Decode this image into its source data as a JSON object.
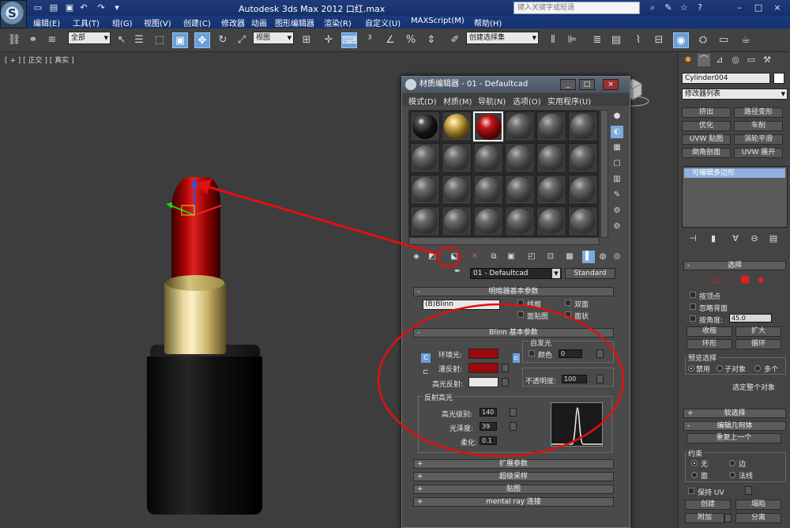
{
  "titlebar": {
    "title": "Autodesk 3ds Max  2012",
    "file": "口红.max",
    "search_placeholder": "键入关键字或短语"
  },
  "menubar": {
    "items": [
      "编辑(E)",
      "工具(T)",
      "组(G)",
      "视图(V)",
      "创建(C)",
      "修改器",
      "动画",
      "图形编辑器",
      "渲染(R)",
      "自定义(U)",
      "MAXScript(M)",
      "帮助(H)"
    ]
  },
  "toolbar": {
    "filter_select": "全部",
    "view_select": "视图",
    "selection_set": "创建选择集"
  },
  "viewport": {
    "label": "[ + ] [ 正交 ] [ 真实 ]"
  },
  "material_editor": {
    "title": "材质编辑器 - 01 - Defaultcad",
    "menu": [
      "模式(D)",
      "材质(M)",
      "导航(N)",
      "选项(O)",
      "实用程序(U)"
    ],
    "material_name": "01 - Defaultcad",
    "material_type": "Standard",
    "shader_rollout": "明暗器基本参数",
    "shader": "(B)Blinn",
    "wire": "线框",
    "two_sided": "双面",
    "face_map": "面贴图",
    "faceted": "面状",
    "blinn_rollout": "Blinn 基本参数",
    "self_illum_title": "自发光",
    "self_illum_color": "颜色",
    "self_illum_value": "0",
    "ambient": "环境光:",
    "diffuse": "漫反射:",
    "specular": "高光反射:",
    "opacity_label": "不透明度:",
    "opacity_value": "100",
    "spec_highlights": "反射高光",
    "spec_level_label": "高光级别:",
    "spec_level": "140",
    "glossiness_label": "光泽度:",
    "glossiness": "39",
    "soften_label": "柔化:",
    "soften": "0.1",
    "more_rollouts": [
      "扩展参数",
      "超级采样",
      "贴图",
      "mental ray 连接"
    ],
    "colors": {
      "ambient": "#9b0a0a",
      "diffuse": "#9b0a0a",
      "specular": "#e8e8e8"
    }
  },
  "command_panel": {
    "object_name": "Cylinder004",
    "modifier_list": "修改器列表",
    "modifier_buttons": [
      "挤出",
      "路径变形",
      "优化",
      "车削",
      "UVW 贴图",
      "涡轮平滑",
      "倒角剖面",
      "UVW 展开"
    ],
    "stack_item": "可编辑多边形",
    "selection_title": "选择",
    "by_vertex": "按顶点",
    "ignore_backfacing": "忽略背面",
    "by_angle": "按角度:",
    "angle_value": "45.0",
    "shrink": "收缩",
    "grow": "扩大",
    "ring": "环形",
    "loop": "循环",
    "preview_title": "预览选择",
    "preview_options": [
      "禁用",
      "子对象",
      "多个"
    ],
    "select_whole": "选定整个对象",
    "soft_selection": "软选择",
    "edit_geometry": "编辑几何体",
    "repeat_last": "重复上一个",
    "constraints_title": "约束",
    "constraints": [
      "无",
      "边",
      "面",
      "法线"
    ],
    "preserve_uv": "保持 UV",
    "create": "创建",
    "collapse": "塌陷",
    "attach": "附加",
    "detach": "分离"
  },
  "annotation_color": "#e01010"
}
